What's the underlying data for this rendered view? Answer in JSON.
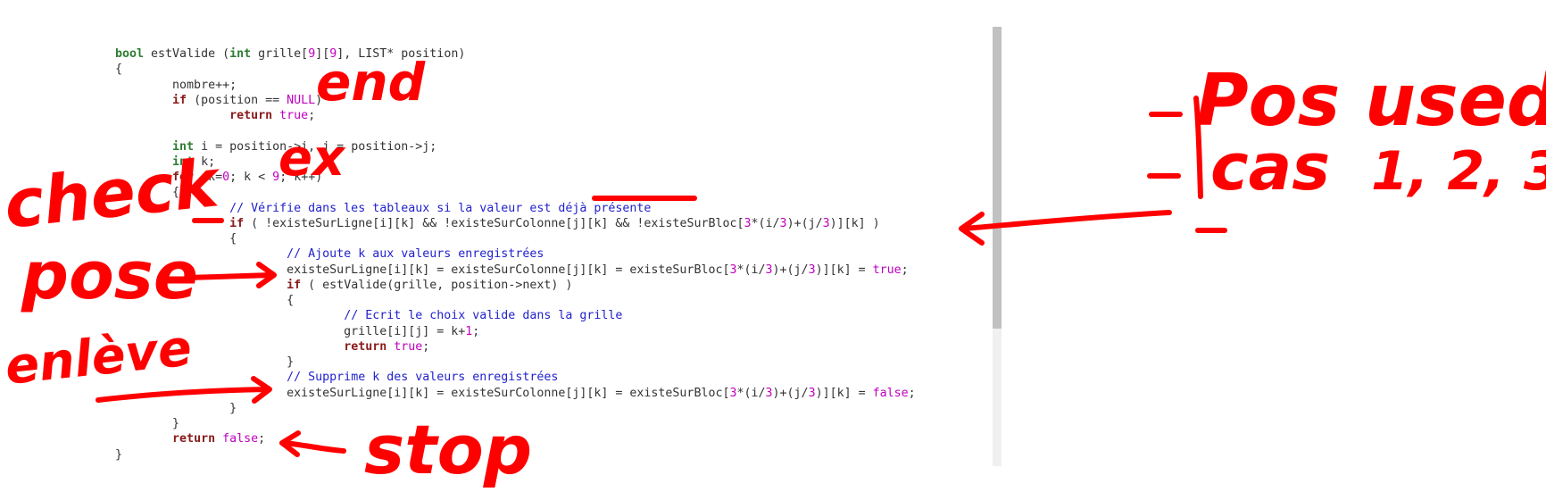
{
  "code": {
    "lines": [
      [
        {
          "t": "type",
          "s": "bool"
        },
        {
          "t": "plain",
          "s": " estValide ("
        },
        {
          "t": "type",
          "s": "int"
        },
        {
          "t": "plain",
          "s": " grille["
        },
        {
          "t": "num",
          "s": "9"
        },
        {
          "t": "plain",
          "s": "]["
        },
        {
          "t": "num",
          "s": "9"
        },
        {
          "t": "plain",
          "s": "], LIST* position)"
        }
      ],
      [
        {
          "t": "plain",
          "s": "{"
        }
      ],
      [
        {
          "t": "plain",
          "s": "        nombre++;"
        }
      ],
      [
        {
          "t": "plain",
          "s": "        "
        },
        {
          "t": "kw",
          "s": "if"
        },
        {
          "t": "plain",
          "s": " (position == "
        },
        {
          "t": "lit",
          "s": "NULL"
        },
        {
          "t": "plain",
          "s": ")"
        }
      ],
      [
        {
          "t": "plain",
          "s": "                "
        },
        {
          "t": "kw",
          "s": "return"
        },
        {
          "t": "plain",
          "s": " "
        },
        {
          "t": "lit",
          "s": "true"
        },
        {
          "t": "plain",
          "s": ";"
        }
      ],
      [
        {
          "t": "plain",
          "s": ""
        }
      ],
      [
        {
          "t": "plain",
          "s": "        "
        },
        {
          "t": "type",
          "s": "int"
        },
        {
          "t": "plain",
          "s": " i = position->i, j = position->j;"
        }
      ],
      [
        {
          "t": "plain",
          "s": "        "
        },
        {
          "t": "type",
          "s": "int"
        },
        {
          "t": "plain",
          "s": " k;"
        }
      ],
      [
        {
          "t": "plain",
          "s": "        "
        },
        {
          "t": "kw",
          "s": "for"
        },
        {
          "t": "plain",
          "s": " (k="
        },
        {
          "t": "num",
          "s": "0"
        },
        {
          "t": "plain",
          "s": "; k < "
        },
        {
          "t": "num",
          "s": "9"
        },
        {
          "t": "plain",
          "s": "; k++)"
        }
      ],
      [
        {
          "t": "plain",
          "s": "        {"
        }
      ],
      [
        {
          "t": "plain",
          "s": "                "
        },
        {
          "t": "cmt",
          "s": "// Vérifie dans les tableaux si la valeur est déjà présente"
        }
      ],
      [
        {
          "t": "plain",
          "s": "                "
        },
        {
          "t": "kw",
          "s": "if"
        },
        {
          "t": "plain",
          "s": " ( !existeSurLigne[i][k] && !existeSurColonne[j][k] && !existeSurBloc["
        },
        {
          "t": "num",
          "s": "3"
        },
        {
          "t": "plain",
          "s": "*(i/"
        },
        {
          "t": "num",
          "s": "3"
        },
        {
          "t": "plain",
          "s": ")+(j/"
        },
        {
          "t": "num",
          "s": "3"
        },
        {
          "t": "plain",
          "s": ")][k] )"
        }
      ],
      [
        {
          "t": "plain",
          "s": "                {"
        }
      ],
      [
        {
          "t": "plain",
          "s": "                        "
        },
        {
          "t": "cmt",
          "s": "// Ajoute k aux valeurs enregistrées"
        }
      ],
      [
        {
          "t": "plain",
          "s": "                        existeSurLigne[i][k] = existeSurColonne[j][k] = existeSurBloc["
        },
        {
          "t": "num",
          "s": "3"
        },
        {
          "t": "plain",
          "s": "*(i/"
        },
        {
          "t": "num",
          "s": "3"
        },
        {
          "t": "plain",
          "s": ")+(j/"
        },
        {
          "t": "num",
          "s": "3"
        },
        {
          "t": "plain",
          "s": ")][k] = "
        },
        {
          "t": "lit",
          "s": "true"
        },
        {
          "t": "plain",
          "s": ";"
        }
      ],
      [
        {
          "t": "plain",
          "s": "                        "
        },
        {
          "t": "kw",
          "s": "if"
        },
        {
          "t": "plain",
          "s": " ( estValide(grille, position->next) )"
        }
      ],
      [
        {
          "t": "plain",
          "s": "                        {"
        }
      ],
      [
        {
          "t": "plain",
          "s": "                                "
        },
        {
          "t": "cmt",
          "s": "// Ecrit le choix valide dans la grille"
        }
      ],
      [
        {
          "t": "plain",
          "s": "                                grille[i][j] = k+"
        },
        {
          "t": "num",
          "s": "1"
        },
        {
          "t": "plain",
          "s": ";"
        }
      ],
      [
        {
          "t": "plain",
          "s": "                                "
        },
        {
          "t": "kw",
          "s": "return"
        },
        {
          "t": "plain",
          "s": " "
        },
        {
          "t": "lit",
          "s": "true"
        },
        {
          "t": "plain",
          "s": ";"
        }
      ],
      [
        {
          "t": "plain",
          "s": "                        }"
        }
      ],
      [
        {
          "t": "plain",
          "s": "                        "
        },
        {
          "t": "cmt",
          "s": "// Supprime k des valeurs enregistrées"
        }
      ],
      [
        {
          "t": "plain",
          "s": "                        existeSurLigne[i][k] = existeSurColonne[j][k] = existeSurBloc["
        },
        {
          "t": "num",
          "s": "3"
        },
        {
          "t": "plain",
          "s": "*(i/"
        },
        {
          "t": "num",
          "s": "3"
        },
        {
          "t": "plain",
          "s": ")+(j/"
        },
        {
          "t": "num",
          "s": "3"
        },
        {
          "t": "plain",
          "s": ")][k] = "
        },
        {
          "t": "lit",
          "s": "false"
        },
        {
          "t": "plain",
          "s": ";"
        }
      ],
      [
        {
          "t": "plain",
          "s": "                }"
        }
      ],
      [
        {
          "t": "plain",
          "s": "        }"
        }
      ],
      [
        {
          "t": "plain",
          "s": "        "
        },
        {
          "t": "kw",
          "s": "return"
        },
        {
          "t": "plain",
          "s": " "
        },
        {
          "t": "lit",
          "s": "false"
        },
        {
          "t": "plain",
          "s": ";"
        }
      ],
      [
        {
          "t": "plain",
          "s": "}"
        }
      ]
    ]
  },
  "annotations": {
    "ink_color": "#ff0000",
    "end_label": "end",
    "ex_label": "ex",
    "check_label": "check",
    "pose_label": "pose",
    "enleve_label": "enlève",
    "stop_label": "stop",
    "pos_used_label": "Pos used",
    "cas_label": "cas",
    "cas_numbers": "1, 2, 3"
  },
  "colors": {
    "type_keyword": "#2e7d32",
    "control_keyword": "#8b1a1a",
    "literal": "#c000c0",
    "comment": "#2222cc",
    "text": "#333333"
  }
}
